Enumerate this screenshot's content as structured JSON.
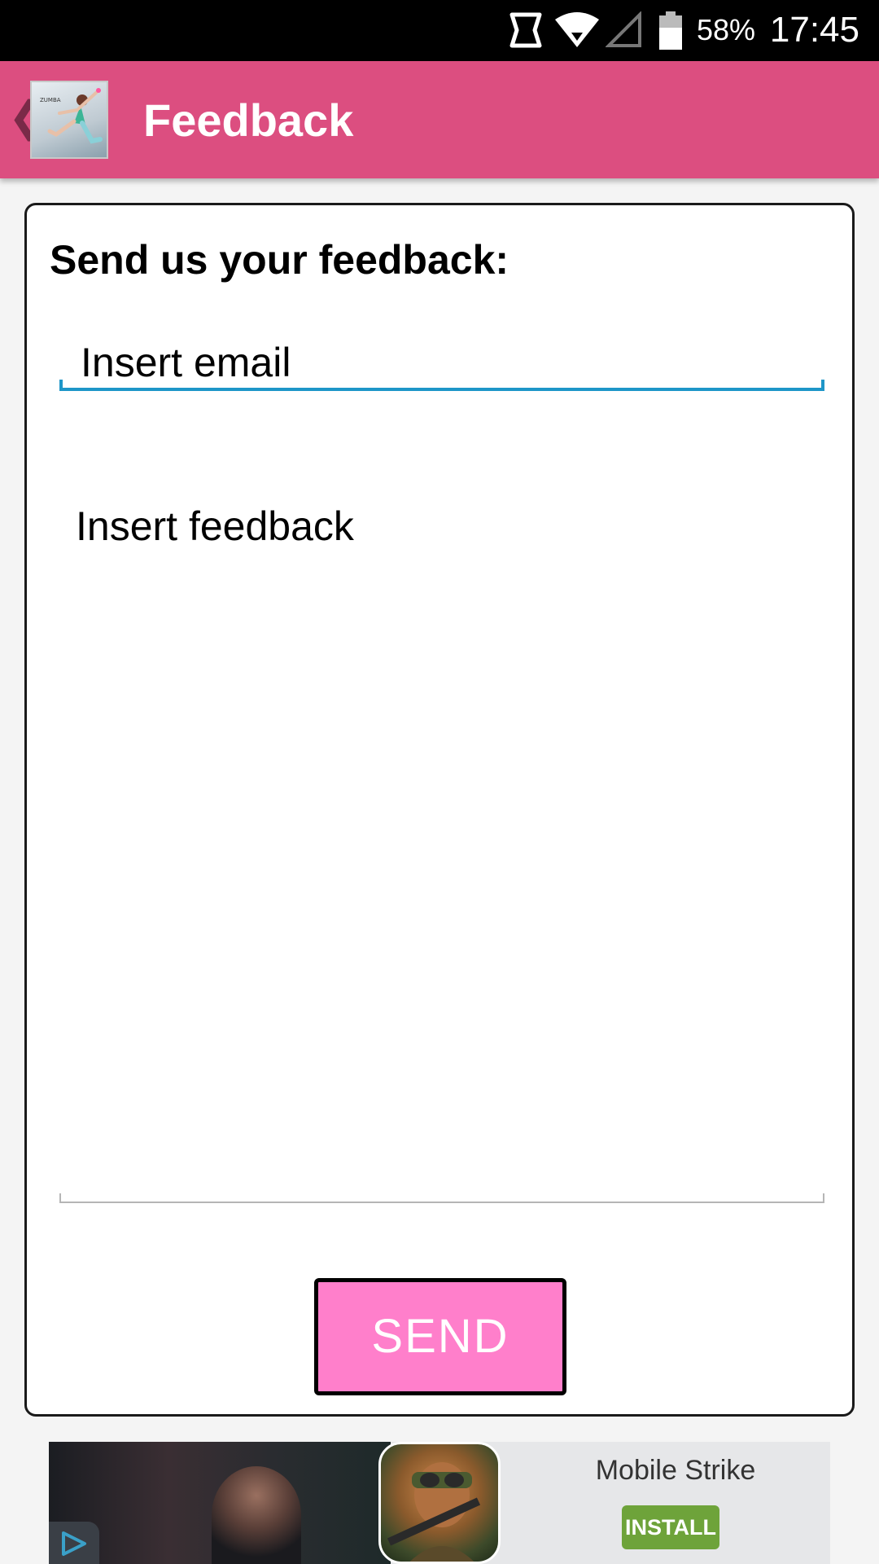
{
  "status_bar": {
    "battery_percent": "58%",
    "time": "17:45",
    "icons": [
      "notification-icon",
      "wifi-icon",
      "signal-icon",
      "battery-icon"
    ]
  },
  "app_bar": {
    "title": "Feedback",
    "logo_text": "ZUMBA",
    "color": "#dc4e80",
    "icons": [
      "back-chevron-icon",
      "app-logo"
    ]
  },
  "form": {
    "heading": "Send us your feedback:",
    "email_placeholder": "Insert email",
    "feedback_placeholder": "Insert feedback",
    "send_label": "SEND",
    "accent_color": "#1e96c8",
    "button_color": "#ff7fcb"
  },
  "ad": {
    "title": "Mobile Strike",
    "install_label": "INSTALL",
    "install_color": "#6ea33a",
    "icons": [
      "ad-choices-icon"
    ]
  }
}
